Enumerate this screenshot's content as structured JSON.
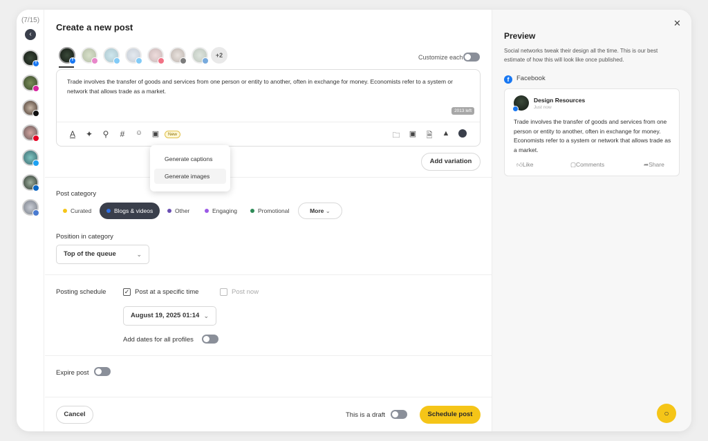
{
  "rail": {
    "count": "(7/15)"
  },
  "composer": {
    "title": "Create a new post",
    "accounts_more": "+2",
    "customize_label": "Customize each",
    "text": "Trade involves the transfer of goods and services from one person or entity to another, often in exchange for money. Economists refer to a system or network that allows trade as a market.",
    "chars_left": "2013 left",
    "new_badge": "New",
    "ai_menu": [
      "Generate captions",
      "Generate images"
    ],
    "add_variation": "Add variation"
  },
  "category": {
    "label": "Post category",
    "items": [
      {
        "label": "Curated",
        "color": "#f5c518"
      },
      {
        "label": "Blogs & videos",
        "color": "#2f6fe4"
      },
      {
        "label": "Other",
        "color": "#6a4fb3"
      },
      {
        "label": "Engaging",
        "color": "#9b59e6"
      },
      {
        "label": "Promotional",
        "color": "#2e8b57"
      }
    ],
    "more": "More",
    "position_label": "Position in category",
    "position_value": "Top of the queue"
  },
  "schedule": {
    "label": "Posting schedule",
    "specific_time": "Post at a specific time",
    "post_now": "Post now",
    "datetime": "August 19, 2025 01:14",
    "add_dates": "Add dates for all profiles"
  },
  "expire": {
    "label": "Expire post"
  },
  "footer": {
    "cancel": "Cancel",
    "draft": "This is a draft",
    "schedule": "Schedule post"
  },
  "preview": {
    "title": "Preview",
    "description": "Social networks tweak their design all the time. This is our best estimate of how this will look like once published.",
    "network": "Facebook",
    "account_name": "Design Resources",
    "time": "Just now",
    "text": "Trade involves the transfer of goods and services from one person or entity to another, often in exchange for money. Economists refer to a system or network that allows trade as a market.",
    "like": "Like",
    "comments": "Comments",
    "share": "Share"
  },
  "colors": {
    "accent": "#f5c518",
    "dark": "#3a3f4b",
    "facebook": "#1877f2"
  }
}
